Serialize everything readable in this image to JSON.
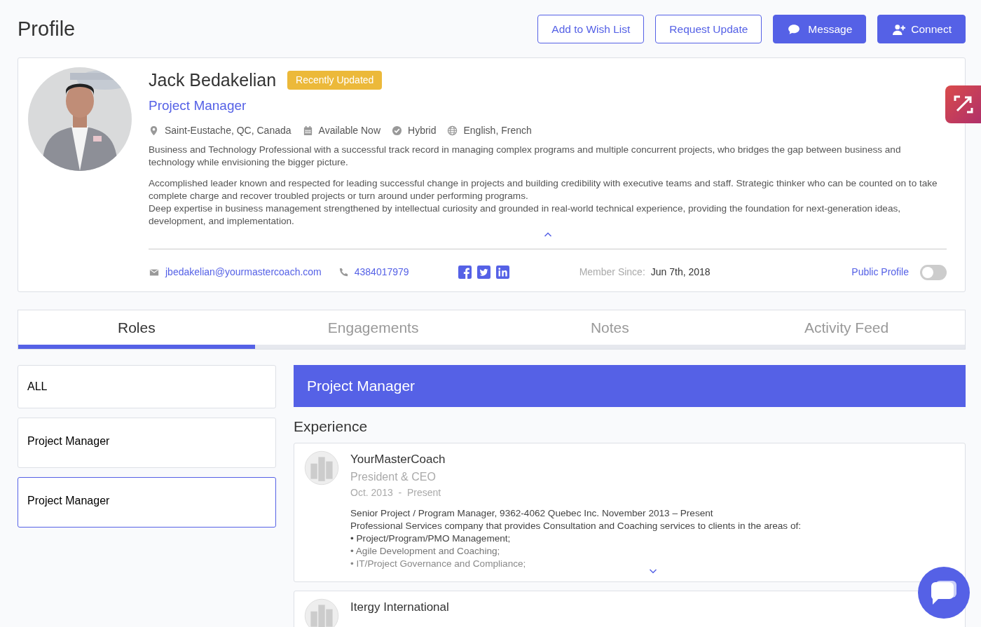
{
  "header": {
    "title": "Profile",
    "buttons": [
      {
        "label": "Add to Wish List",
        "kind": "outline"
      },
      {
        "label": "Request Update",
        "kind": "outline"
      },
      {
        "label": "Message",
        "kind": "message"
      },
      {
        "label": "Connect",
        "kind": "connect"
      }
    ]
  },
  "profile": {
    "name": "Jack Bedakelian",
    "badge": "Recently Updated",
    "role": "Project Manager",
    "meta": [
      {
        "kind": "location",
        "text": "Saint-Eustache, QC, Canada"
      },
      {
        "kind": "calendar",
        "text": "Available Now"
      },
      {
        "kind": "check",
        "text": "Hybrid"
      },
      {
        "kind": "globe",
        "text": "English, French"
      }
    ],
    "bio": [
      [
        "Business and Technology Professional with a successful track record in managing complex programs and multiple concurrent projects, who bridges the gap between business and technology while envisioning the bigger picture."
      ],
      [
        "Accomplished leader known and respected for leading successful change in projects and building credibility with executive teams and staff. Strategic thinker who can be counted on to take complete charge and recover troubled projects or turn around under performing programs.",
        "Deep expertise in business management strengthened by intellectual curiosity and grounded in real-world technical experience, providing the foundation for next-generation ideas, development, and implementation."
      ]
    ],
    "bio_expanded": true,
    "email": "jbedakelian@yourmastercoach.com",
    "phone": "4384017979",
    "social": [
      {
        "kind": "facebook"
      },
      {
        "kind": "twitter"
      },
      {
        "kind": "linkedin"
      }
    ],
    "member_since_label": "Member Since:",
    "member_since": "Jun 7th, 2018",
    "public_profile": {
      "label": "Public Profile",
      "on": false
    }
  },
  "tabs": [
    {
      "label": "Roles",
      "selected": true
    },
    {
      "label": "Engagements",
      "selected": false
    },
    {
      "label": "Notes",
      "selected": false
    },
    {
      "label": "Activity Feed",
      "selected": false
    }
  ],
  "roles": [
    {
      "label": "ALL",
      "selected": false
    },
    {
      "label": "Project Manager",
      "selected": false
    },
    {
      "label": "Project Manager",
      "selected": true
    }
  ],
  "detail": {
    "title": "Project Manager",
    "section": "Experience",
    "experiences": [
      {
        "company": "YourMasterCoach",
        "title": "President & CEO",
        "dates": "Oct. 2013  -  Present",
        "lines": [
          "Senior Project / Program Manager, 9362-4062 Quebec Inc. November 2013 – Present",
          "Professional Services company that provides Consultation and Coaching services to clients in the areas of:",
          "• Project/Program/PMO Management;",
          "• Agile Development and Coaching;",
          "• IT/Project Governance and Compliance;"
        ]
      },
      {
        "company": "Itergy International"
      }
    ]
  }
}
